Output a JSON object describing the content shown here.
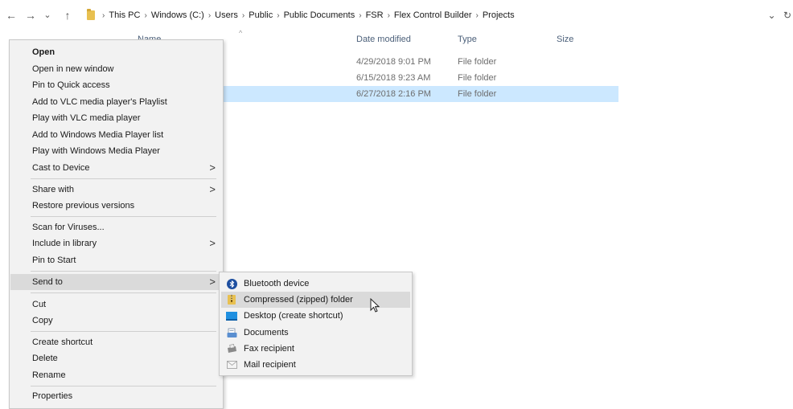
{
  "address_bar": {
    "back_glyph": "←",
    "forward_glyph": "→",
    "recent_glyph": "⌄",
    "up_glyph": "↑",
    "separator": "›",
    "breadcrumbs": [
      "This PC",
      "Windows (C:)",
      "Users",
      "Public",
      "Public Documents",
      "FSR",
      "Flex Control Builder",
      "Projects"
    ],
    "dropdown_glyph": "⌄",
    "refresh_glyph": "↻"
  },
  "file_list": {
    "columns": {
      "name": "Name",
      "date_modified": "Date modified",
      "type": "Type",
      "size": "Size"
    },
    "sort_glyph": "^",
    "rows": [
      {
        "date": "4/29/2018 9:01 PM",
        "type": "File folder",
        "size": ""
      },
      {
        "date": "6/15/2018 9:23 AM",
        "type": "File folder",
        "size": ""
      },
      {
        "date": "6/27/2018 2:16 PM",
        "type": "File folder",
        "size": "",
        "selected": true
      }
    ]
  },
  "context_menu": {
    "arrow_glyph": ">",
    "items": {
      "open": "Open",
      "open_new_window": "Open in new window",
      "pin_quick_access": "Pin to Quick access",
      "add_vlc_playlist": "Add to VLC media player's Playlist",
      "play_vlc": "Play with VLC media player",
      "add_wmp_list": "Add to Windows Media Player list",
      "play_wmp": "Play with Windows Media Player",
      "cast_to_device": "Cast to Device",
      "share_with": "Share with",
      "restore_previous": "Restore previous versions",
      "scan_viruses": "Scan for Viruses...",
      "include_library": "Include in library",
      "pin_start": "Pin to Start",
      "send_to": "Send to",
      "cut": "Cut",
      "copy": "Copy",
      "create_shortcut": "Create shortcut",
      "delete": "Delete",
      "rename": "Rename",
      "properties": "Properties"
    }
  },
  "send_to_menu": {
    "items": [
      {
        "label": "Bluetooth device",
        "icon": "bluetooth-icon"
      },
      {
        "label": "Compressed (zipped) folder",
        "icon": "zip-folder-icon"
      },
      {
        "label": "Desktop (create shortcut)",
        "icon": "desktop-icon"
      },
      {
        "label": "Documents",
        "icon": "documents-icon"
      },
      {
        "label": "Fax recipient",
        "icon": "fax-icon"
      },
      {
        "label": "Mail recipient",
        "icon": "mail-icon"
      }
    ]
  },
  "colors": {
    "selection": "#cce8ff",
    "menu_bg": "#f2f2f2",
    "menu_hover": "#dadada",
    "header_text": "#4c607a",
    "bluetooth": "#1e4fa0",
    "folder": "#e8c050",
    "desktop": "#1f8fe0"
  }
}
